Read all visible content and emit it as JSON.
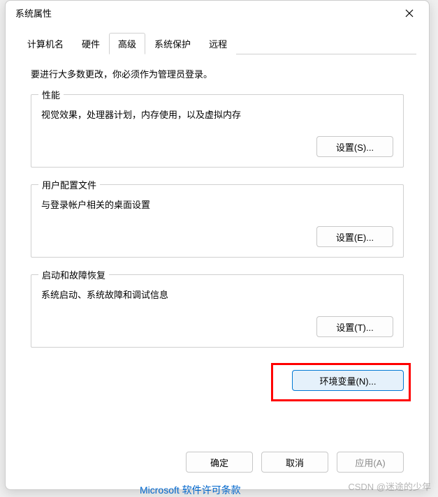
{
  "window": {
    "title": "系统属性"
  },
  "tabs": {
    "items": [
      {
        "label": "计算机名"
      },
      {
        "label": "硬件"
      },
      {
        "label": "高级"
      },
      {
        "label": "系统保护"
      },
      {
        "label": "远程"
      }
    ],
    "active_index": 2
  },
  "admin_note": "要进行大多数更改，你必须作为管理员登录。",
  "sections": {
    "performance": {
      "legend": "性能",
      "description": "视觉效果，处理器计划，内存使用，以及虚拟内存",
      "button": "设置(S)..."
    },
    "user_profile": {
      "legend": "用户配置文件",
      "description": "与登录帐户相关的桌面设置",
      "button": "设置(E)..."
    },
    "startup": {
      "legend": "启动和故障恢复",
      "description": "系统启动、系统故障和调试信息",
      "button": "设置(T)..."
    }
  },
  "env_button": "环境变量(N)...",
  "footer": {
    "ok": "确定",
    "cancel": "取消",
    "apply": "应用(A)"
  },
  "watermark": "CSDN @迷途的少年",
  "bg_link": "Microsoft 软件许可条款"
}
